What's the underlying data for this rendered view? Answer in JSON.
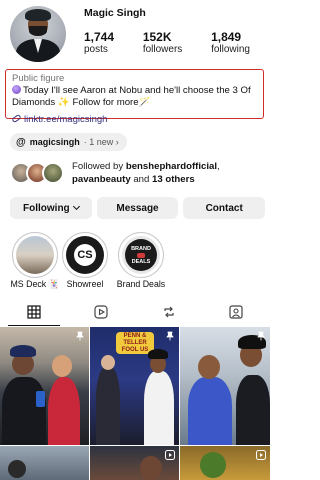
{
  "profile": {
    "name": "Magic Singh",
    "stats": [
      {
        "value": "1,744",
        "label": "posts"
      },
      {
        "value": "152K",
        "label": "followers"
      },
      {
        "value": "1,849",
        "label": "following"
      }
    ]
  },
  "bio": {
    "category": "Public figure",
    "text": "Today I'll see Aaron at Nobu and he'll choose the 3 Of Diamonds ✨ Follow for more🪄",
    "link": "linktr.ee/magicsingh"
  },
  "threads": {
    "name": "magicsingh",
    "badge": "· 1 new ›"
  },
  "followed_by": {
    "prefix": "Followed by ",
    "user1": "benshephardofficial",
    "sep": ",",
    "user2": "pavanbeauty",
    "mid": " and ",
    "others": "13 others"
  },
  "actions": {
    "following": "Following",
    "message": "Message",
    "contact": "Contact"
  },
  "highlights": [
    {
      "label": "MS Deck 🃏",
      "icon": "ms-deck-thumbnail"
    },
    {
      "label": "Showreel",
      "mark": "CS"
    },
    {
      "label": "Brand Deals",
      "mark_top": "BRAND",
      "mark_bottom": "DEALS"
    }
  ],
  "tabs": [
    "grid-icon",
    "reels-icon",
    "reposts-icon",
    "tagged-icon"
  ],
  "grid": {
    "post2_sign": "FOOL US",
    "post2_sign_top": "PENN & TELLER"
  },
  "colors": {
    "highlight_box": "#d12b2b",
    "link": "#37357f",
    "button_bg": "#efefef"
  }
}
